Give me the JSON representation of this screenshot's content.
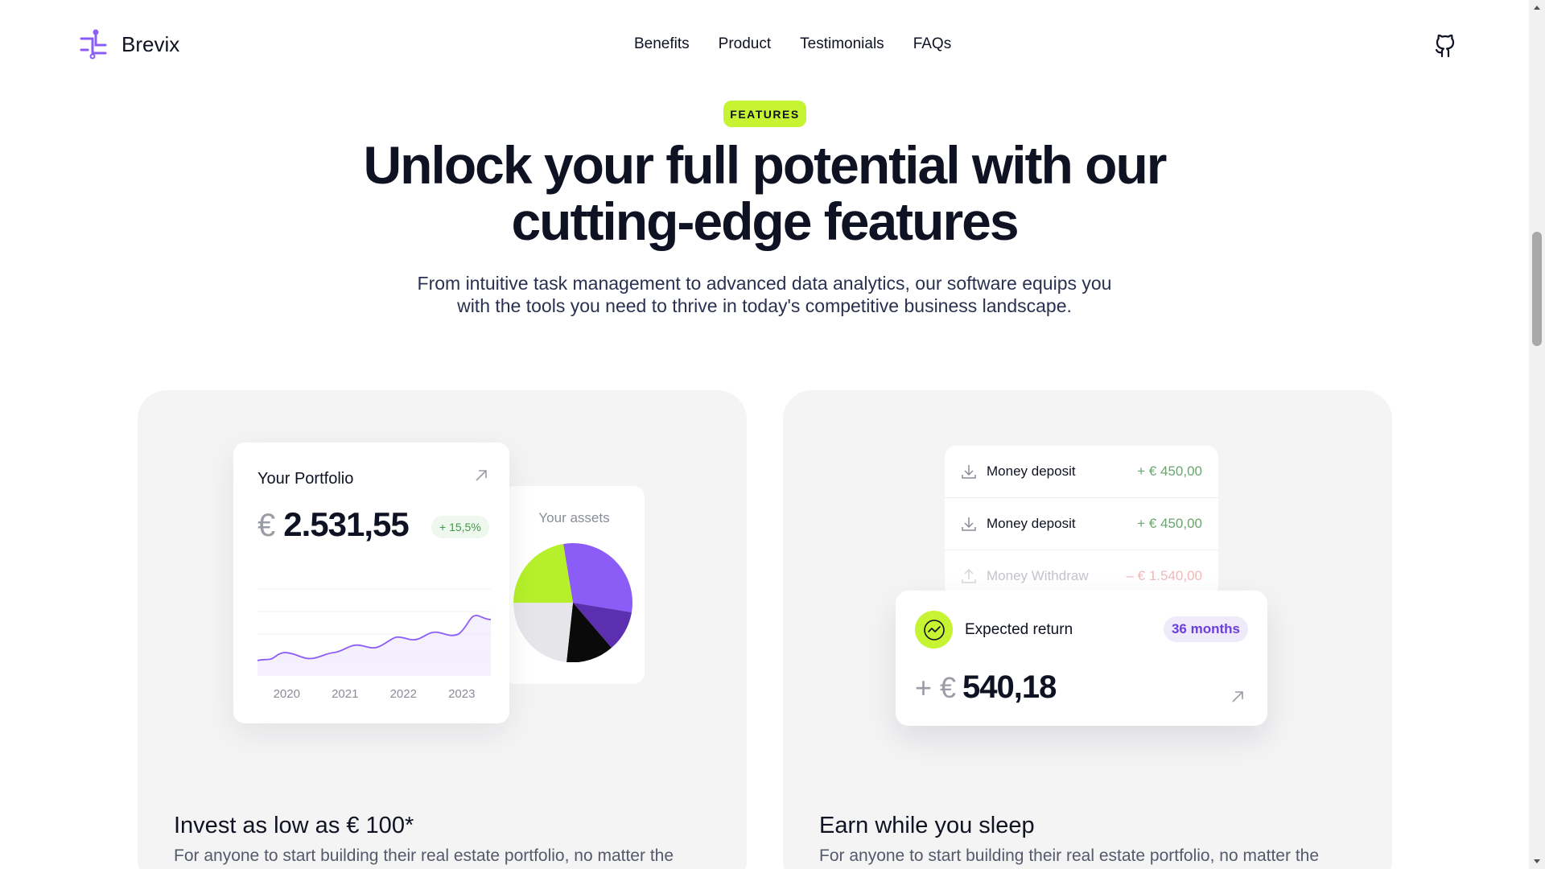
{
  "brand": {
    "name": "Brevix",
    "accent": "#8b5cf6",
    "lime": "#c6f432"
  },
  "nav": {
    "items": [
      "Benefits",
      "Product",
      "Testimonials",
      "FAQs"
    ]
  },
  "hero": {
    "badge": "FEATURES",
    "title": "Unlock your full potential with our cutting-edge features",
    "subtitle": "From intuitive task management to advanced data analytics, our software equips you with the tools you need to thrive in today's competitive business landscape."
  },
  "card_left": {
    "title": "Invest as low as € 100*",
    "description": "For anyone to start building their real estate portfolio, no matter the",
    "portfolio": {
      "title": "Your Portfolio",
      "currency": "€",
      "amount": "2.531,55",
      "change": "+ 15,5%",
      "years": [
        "2020",
        "2021",
        "2022",
        "2023"
      ]
    },
    "assets": {
      "label": "Your assets"
    }
  },
  "card_right": {
    "title": "Earn while you sleep",
    "description": "For anyone to start building their real estate portfolio, no matter the",
    "transactions": [
      {
        "label": "Money deposit",
        "amount": "+ € 450,00",
        "icon": "download-icon"
      },
      {
        "label": "Money deposit",
        "amount": "+ € 450,00",
        "icon": "download-icon"
      },
      {
        "label": "Money Withdraw",
        "amount": "– € 1.540,00",
        "icon": "upload-icon"
      }
    ],
    "return": {
      "label": "Expected return",
      "period": "36 months",
      "prefix": "+ €",
      "amount": "540,18"
    }
  }
}
